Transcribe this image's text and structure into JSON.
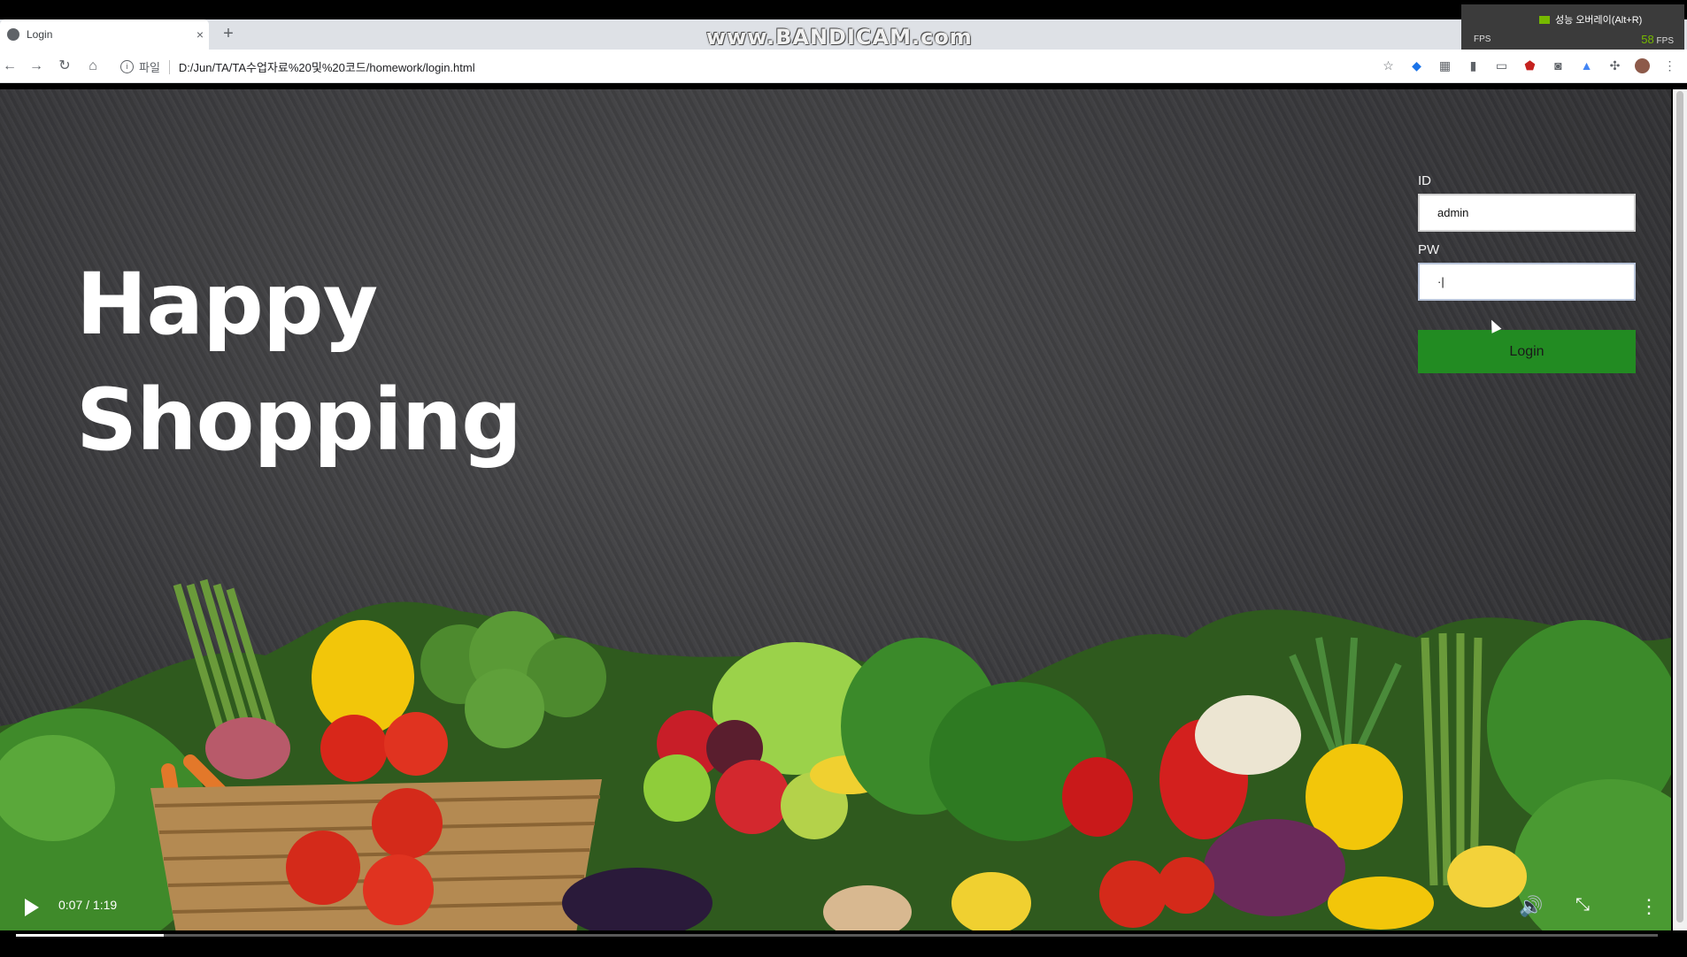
{
  "browser": {
    "tab_title": "Login",
    "tab_close": "×",
    "new_tab": "+",
    "url_scheme_label": "파일",
    "url": "D:/Jun/TA/TA수업자료%20및%20코드/homework/login.html"
  },
  "watermark": "www.BANDICAM.com",
  "overlay": {
    "title": "성능 오버레이(Alt+R)",
    "fps_label": "FPS",
    "fps_value": "58",
    "fps_unit": "FPS"
  },
  "hero": {
    "line1": "Happy",
    "line2": "Shopping"
  },
  "login": {
    "id_label": "ID",
    "id_value": "admin",
    "pw_label": "PW",
    "pw_value": "·|",
    "button_label": "Login"
  },
  "video": {
    "timecode": "0:07 / 1:19",
    "progress_fraction": 0.09
  }
}
